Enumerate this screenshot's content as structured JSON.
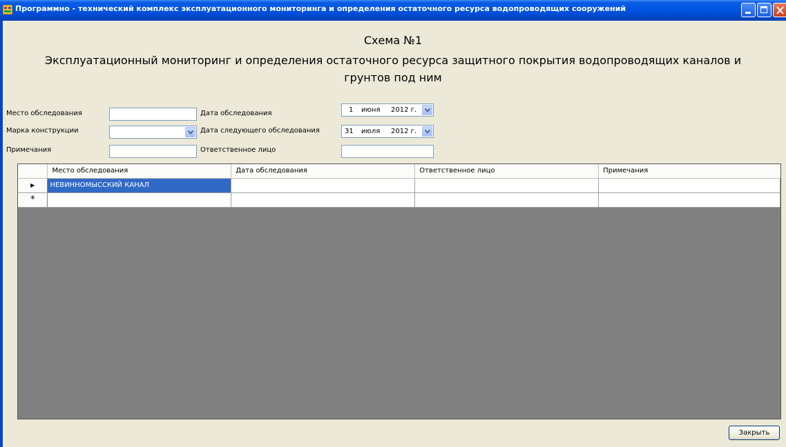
{
  "window": {
    "title": "Программно - технический комплекс эксплуатационного мониторинга и определения остаточного ресурса водопроводящих сооружений"
  },
  "header": {
    "scheme": "Схема №1",
    "subtitle": "Эксплуатационный мониторинг и определения остаточного ресурса защитного покрытия водопроводящих каналов и грунтов под ним"
  },
  "form": {
    "location_label": "Место обследования",
    "location_value": "",
    "brand_label": "Марка конструкции",
    "brand_value": "",
    "notes_label": "Примечания",
    "notes_value": "",
    "survey_date_label": "Дата обследования",
    "survey_date": {
      "day": "1",
      "month": "июня",
      "year": "2012 г."
    },
    "next_date_label": "Дата следующего обследования",
    "next_date": {
      "day": "31",
      "month": "июля",
      "year": "2012 г."
    },
    "responsible_label": "Ответственное лицо",
    "responsible_value": ""
  },
  "grid": {
    "columns": [
      "Место обследования",
      "Дата обследования",
      "Ответственное лицо",
      "Примечания"
    ],
    "rows": [
      [
        "НЕВИННОМЫССКИЙ КАНАЛ",
        "",
        "",
        ""
      ]
    ],
    "new_row_marker": "*",
    "current_row_marker": "▶"
  },
  "footer": {
    "close_label": "Закрыть"
  },
  "colors": {
    "titlebar": "#0054e3",
    "selection": "#316ac5",
    "grid_empty": "#808080",
    "window_bg": "#ece9d8"
  }
}
